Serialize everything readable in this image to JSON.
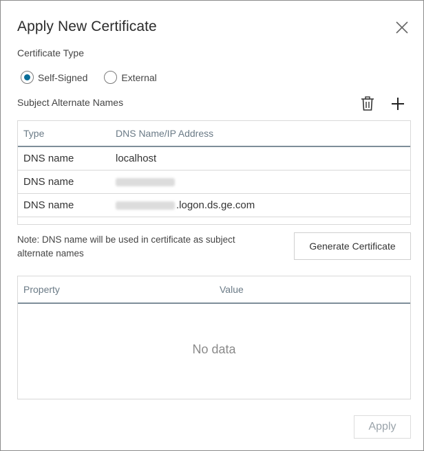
{
  "dialog": {
    "title": "Apply New Certificate"
  },
  "certificate_type": {
    "label": "Certificate Type",
    "options": [
      {
        "label": "Self-Signed",
        "checked": true
      },
      {
        "label": "External",
        "checked": false
      }
    ]
  },
  "san": {
    "label": "Subject Alternate Names",
    "delete_icon": "trash-icon",
    "add_icon": "plus-icon",
    "columns": [
      "Type",
      "DNS Name/IP Address"
    ],
    "rows": [
      {
        "type": "DNS name",
        "value": "localhost",
        "redacted": false
      },
      {
        "type": "DNS name",
        "value": "",
        "redacted": true
      },
      {
        "type": "DNS name",
        "value": ".logon.ds.ge.com",
        "redacted": true
      }
    ]
  },
  "note": "Note: DNS name will be used in certificate as subject alternate names",
  "generate_button": "Generate Certificate",
  "properties": {
    "columns": [
      "Property",
      "Value"
    ],
    "empty_text": "No data"
  },
  "apply_button": "Apply",
  "colors": {
    "accent": "#0b6e99",
    "header_rule": "#7d8d99",
    "disabled_text": "#9aa3aa"
  }
}
